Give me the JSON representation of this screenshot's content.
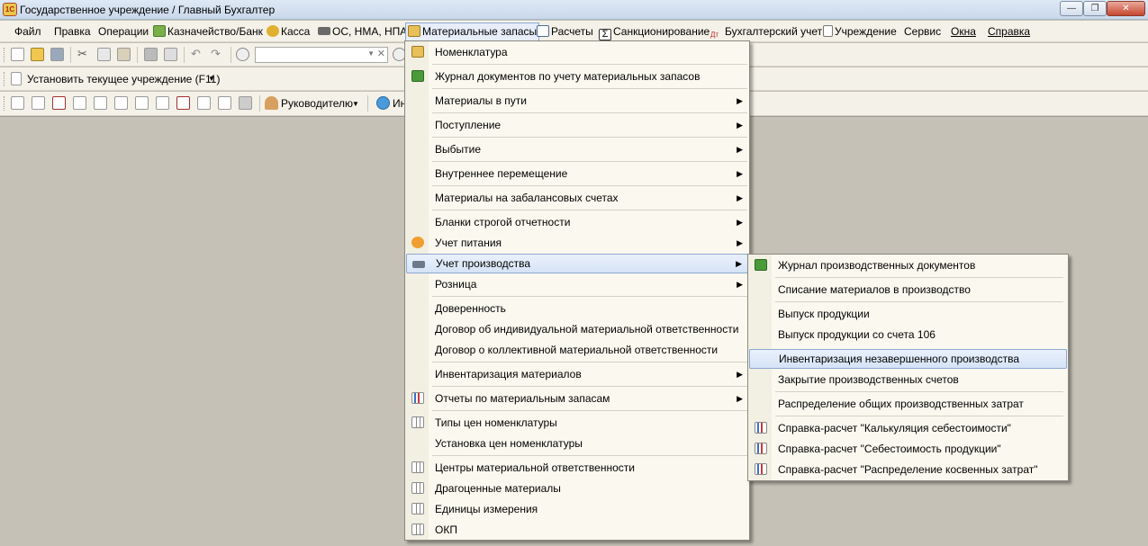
{
  "window": {
    "title": "Государственное учреждение / Главный Бухгалтер",
    "app_icon_text": "1С",
    "controls": [
      "—",
      "❐",
      "✕"
    ]
  },
  "menubar": [
    {
      "label": "Файл",
      "icon": "none"
    },
    {
      "label": "Правка",
      "icon": "none"
    },
    {
      "label": "Операции",
      "icon": "none"
    },
    {
      "label": "Казначейство/Банк",
      "icon": "treasury-icon"
    },
    {
      "label": "Касса",
      "icon": "coins-icon"
    },
    {
      "label": "ОС, НМА, НПА",
      "icon": "truck-icon"
    },
    {
      "label": "Материальные запасы",
      "icon": "boxes-icon",
      "active": true
    },
    {
      "label": "Расчеты",
      "icon": "calc-icon"
    },
    {
      "label": "Санкционирование",
      "icon": "sigma-icon"
    },
    {
      "label": "Бухгалтерский учет",
      "icon": "dt-kt-icon"
    },
    {
      "label": "Учреждение",
      "icon": "document-icon"
    },
    {
      "label": "Сервис",
      "icon": "none"
    },
    {
      "label": "Окна",
      "icon": "none"
    },
    {
      "label": "Справка",
      "icon": "none"
    }
  ],
  "toolbar2": {
    "set_institution_label": "Установить текущее учреждение (F11)"
  },
  "toolbar3": {
    "manager_label": "Руководителю",
    "truncated_label": "Ин"
  },
  "main_menu": [
    {
      "label": "Номенклатура",
      "icon": "box-icon",
      "arrow": false
    },
    {
      "label": "Журнал документов по учету материальных запасов",
      "icon": "journal-icon",
      "arrow": false
    },
    {
      "label": "Материалы в пути",
      "arrow": true
    },
    {
      "label": "Поступление",
      "arrow": true
    },
    {
      "label": "Выбытие",
      "arrow": true
    },
    {
      "label": "Внутреннее перемещение",
      "arrow": true
    },
    {
      "label": "Материалы на забалансовых счетах",
      "arrow": true
    },
    {
      "label": "Бланки строгой отчетности",
      "arrow": true
    },
    {
      "label": "Учет питания",
      "icon": "food-icon",
      "arrow": true
    },
    {
      "label": "Учет производства",
      "icon": "anvil-icon",
      "arrow": true,
      "highlighted": true
    },
    {
      "label": "Розница",
      "arrow": true
    },
    {
      "label": "Доверенность",
      "arrow": false
    },
    {
      "label": "Договор об индивидуальной материальной ответственности",
      "arrow": false
    },
    {
      "label": "Договор о коллективной материальной ответственности",
      "arrow": false
    },
    {
      "label": "Инвентаризация материалов",
      "arrow": true
    },
    {
      "label": "Отчеты по материальным запасам",
      "icon": "chart-icon",
      "arrow": true
    },
    {
      "label": "Типы цен номенклатуры",
      "icon": "grid-icon",
      "arrow": false
    },
    {
      "label": "Установка цен номенклатуры",
      "arrow": false
    },
    {
      "label": "Центры материальной ответственности",
      "icon": "grid-icon",
      "arrow": false
    },
    {
      "label": "Драгоценные материалы",
      "icon": "grid-icon",
      "arrow": false
    },
    {
      "label": "Единицы измерения",
      "icon": "grid-icon",
      "arrow": false
    },
    {
      "label": "ОКП",
      "icon": "grid-icon",
      "arrow": false
    }
  ],
  "sub_menu": [
    {
      "label": "Журнал производственных документов",
      "icon": "journal-icon"
    },
    {
      "label": "Списание материалов в производство"
    },
    {
      "label": "Выпуск продукции"
    },
    {
      "label": "Выпуск продукции со счета 106"
    },
    {
      "label": "Инвентаризация незавершенного производства",
      "highlighted": true
    },
    {
      "label": "Закрытие производственных счетов"
    },
    {
      "label": "Распределение общих производственных затрат"
    },
    {
      "label": "Справка-расчет \"Калькуляция себестоимости\"",
      "icon": "chart-icon"
    },
    {
      "label": "Справка-расчет \"Себестоимость продукции\"",
      "icon": "chart-icon"
    },
    {
      "label": "Справка-расчет \"Распределение косвенных затрат\"",
      "icon": "chart-icon"
    }
  ]
}
